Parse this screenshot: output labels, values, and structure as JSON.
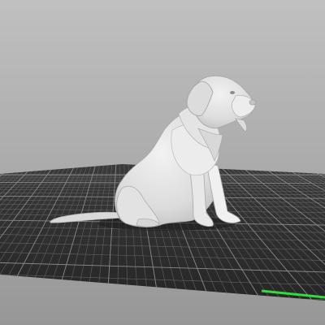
{
  "viewport": {
    "view": "3d-model-preview",
    "colors": {
      "background_top": "#bdbdbd",
      "background_bottom": "#9a9a9a",
      "bed_surface": "#2e2e2e",
      "grid_line": "#6a6a6a",
      "grid_major_line": "#909090",
      "model": "#e6e6e6",
      "model_shade": "#bcbcbc",
      "axis_x": "#2fdc3c"
    },
    "model": {
      "name_icon": "seated-dog-model",
      "description_visible": false
    }
  }
}
